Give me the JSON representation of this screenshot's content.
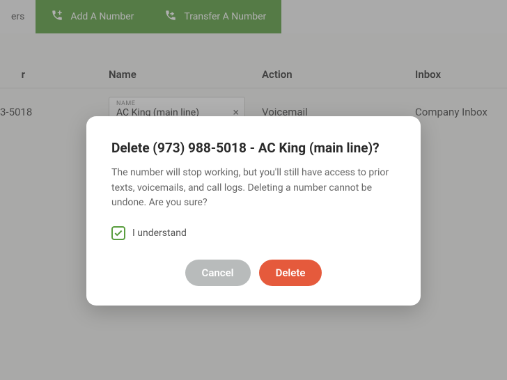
{
  "tabs": {
    "partial_left": "ers",
    "add_number": "Add A Number",
    "transfer_number": "Transfer A Number"
  },
  "table": {
    "headers": {
      "number_partial": "r",
      "name": "Name",
      "action": "Action",
      "inbox": "Inbox"
    },
    "row": {
      "number_partial": "3-5018",
      "name_label": "NAME",
      "name_value": "AC King (main line)",
      "action": "Voicemail",
      "inbox": "Company Inbox"
    }
  },
  "modal": {
    "title": "Delete (973) 988-5018 - AC King (main line)?",
    "body": "The number will stop working, but you'll still have access to prior texts, voicemails, and call logs. Deleting a number cannot be undone. Are you sure?",
    "check_label": "I understand",
    "cancel": "Cancel",
    "delete": "Delete"
  }
}
